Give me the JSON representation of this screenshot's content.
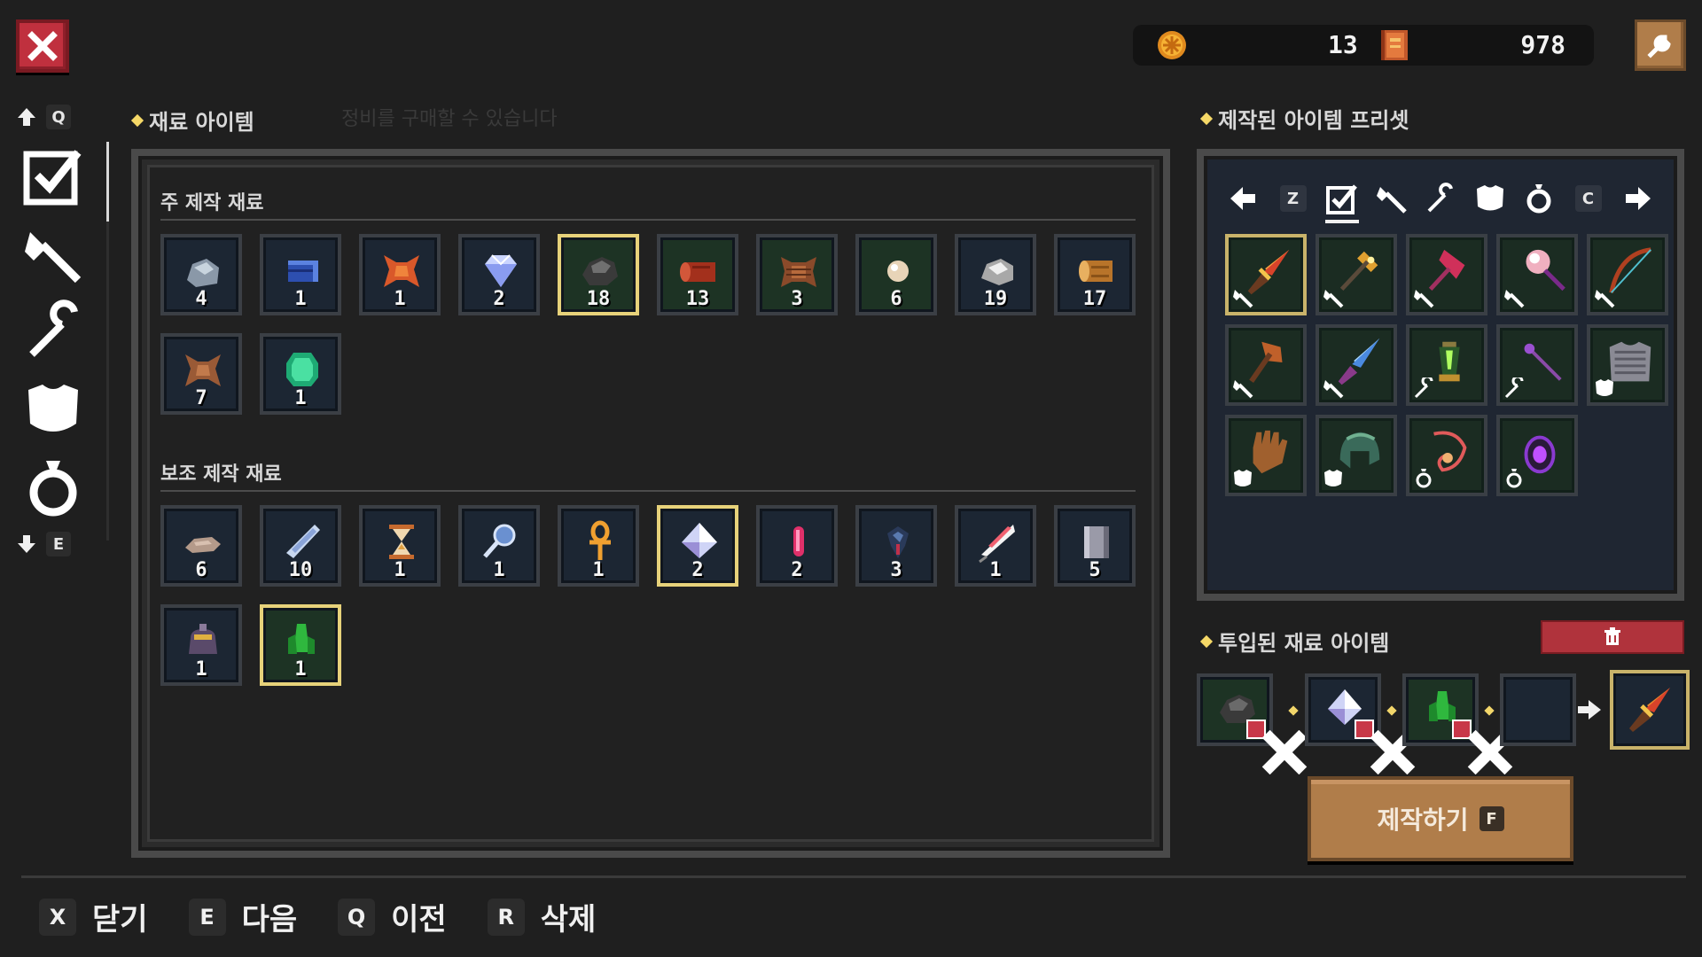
{
  "header": {
    "coin_value": "13",
    "book_value": "978",
    "colors": {
      "close": "#c0303e",
      "wrench": "#b07d4a",
      "gold": "#f5d867"
    }
  },
  "sidebar": {
    "up_key": "Q",
    "down_key": "E",
    "categories": [
      "all-check-icon",
      "hammer-icon",
      "staff-icon",
      "armor-icon",
      "ring-icon"
    ]
  },
  "materials": {
    "title": "재료 아이템",
    "ghost_hint": "정비를 구매할 수 있습니다",
    "main_title": "주 제작 재료",
    "main_items": [
      {
        "icon": "stone-icon",
        "count": "4"
      },
      {
        "icon": "blue-cloth-icon",
        "count": "1"
      },
      {
        "icon": "leather-hide-icon",
        "count": "1"
      },
      {
        "icon": "diamond-icon",
        "count": "2"
      },
      {
        "icon": "coal-ore-icon",
        "count": "18"
      },
      {
        "icon": "red-log-icon",
        "count": "13"
      },
      {
        "icon": "brown-hide-icon",
        "count": "3"
      },
      {
        "icon": "pearl-icon",
        "count": "6"
      },
      {
        "icon": "silver-ore-icon",
        "count": "19"
      },
      {
        "icon": "wood-log-icon",
        "count": "17"
      },
      {
        "icon": "hide-scrap-icon",
        "count": "7"
      },
      {
        "icon": "emerald-icon",
        "count": "1"
      }
    ],
    "sub_title": "보조 제작 재료",
    "sub_items": [
      {
        "icon": "pebble-icon",
        "count": "6"
      },
      {
        "icon": "feather-shard-icon",
        "count": "10"
      },
      {
        "icon": "hourglass-icon",
        "count": "1"
      },
      {
        "icon": "magnifier-icon",
        "count": "1"
      },
      {
        "icon": "ankh-icon",
        "count": "1"
      },
      {
        "icon": "crystal-icon",
        "count": "2"
      },
      {
        "icon": "pink-vial-icon",
        "count": "2"
      },
      {
        "icon": "dark-gem-icon",
        "count": "3"
      },
      {
        "icon": "quill-icon",
        "count": "1"
      },
      {
        "icon": "metal-plate-icon",
        "count": "5"
      },
      {
        "icon": "pouch-icon",
        "count": "1"
      },
      {
        "icon": "green-crystal-icon",
        "count": "1"
      }
    ]
  },
  "presets": {
    "title": "제작된 아이템 프리셋",
    "prev_key": "Z",
    "next_key": "C",
    "items": [
      "flame-sword-icon",
      "golden-mace-icon",
      "crimson-spear-icon",
      "pink-orb-staff-icon",
      "teal-bow-icon",
      "bronze-axe-icon",
      "ice-sword-icon",
      "green-lantern-icon",
      "purple-wand-icon",
      "chainmail-icon",
      "leather-glove-icon",
      "green-helm-icon",
      "rope-necklace-icon",
      "void-amulet-icon"
    ]
  },
  "inputs": {
    "title": "투입된 재료 아이템",
    "slots": [
      "coal-ore-icon",
      "crystal-icon",
      "green-crystal-icon",
      ""
    ],
    "result": "flame-sword-icon"
  },
  "craft": {
    "label": "제작하기",
    "key": "F"
  },
  "hints": [
    {
      "key": "X",
      "label": "닫기"
    },
    {
      "key": "E",
      "label": "다음"
    },
    {
      "key": "Q",
      "label": "이전"
    },
    {
      "key": "R",
      "label": "삭제"
    }
  ]
}
